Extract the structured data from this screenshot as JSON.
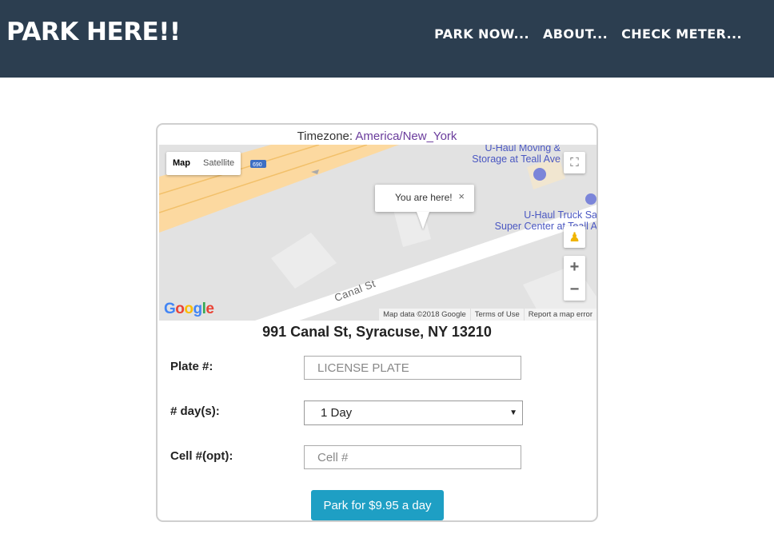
{
  "app": {
    "brand": "PARK HERE!!"
  },
  "nav": {
    "items": [
      {
        "label": "PARK NOW..."
      },
      {
        "label": "ABOUT..."
      },
      {
        "label": "CHECK METER..."
      }
    ]
  },
  "timezone": {
    "label": "Timezone:",
    "value": "America/New_York"
  },
  "map": {
    "type_buttons": [
      "Map",
      "Satellite"
    ],
    "infowindow": "You are here!",
    "poi_1": {
      "line1": "U-Haul Moving &",
      "line2": "Storage at Teall Ave"
    },
    "poi_2": {
      "line1": "U-Haul Truck Sa",
      "line2": "Super Center at Teall A"
    },
    "road": "Canal St",
    "highway_shield": "690",
    "logo": "Google",
    "attribution": [
      "Map data ©2018 Google",
      "Terms of Use",
      "Report a map error"
    ],
    "icons": {
      "fullscreen": "fullscreen-icon",
      "pegman": "pegman-icon",
      "zoom_in": "+",
      "zoom_out": "−",
      "close": "×"
    }
  },
  "address": "991 Canal St, Syracuse, NY 13210",
  "form": {
    "plate": {
      "label": "Plate #:",
      "placeholder": "LICENSE PLATE",
      "value": ""
    },
    "days": {
      "label": "# day(s):",
      "selected": "1 Day"
    },
    "cell": {
      "label": "Cell #(opt):",
      "placeholder": "Cell #",
      "value": ""
    },
    "submit_label": "Park for $9.95 a day"
  },
  "colors": {
    "navbar": "#2c3e50",
    "button": "#1e9fc4",
    "link": "#6a3c9c",
    "poi": "#4a57c2"
  }
}
